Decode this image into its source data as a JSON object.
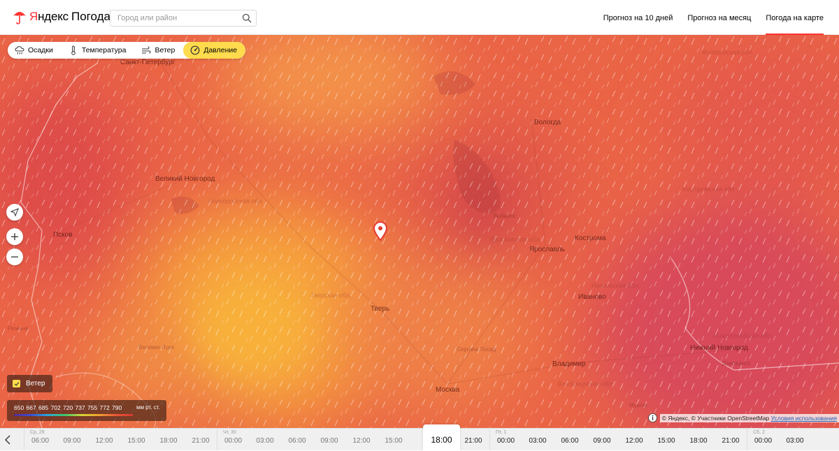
{
  "header": {
    "logo_brand_ya": "Я",
    "logo_brand_rest": "ндекс",
    "logo_product": "Погода",
    "search_placeholder": "Город или район",
    "nav": [
      {
        "label": "Прогноз на 10 дней",
        "active": false
      },
      {
        "label": "Прогноз на месяц",
        "active": false
      },
      {
        "label": "Погода на карте",
        "active": true
      }
    ]
  },
  "layers": [
    {
      "label": "Осадки",
      "icon": "cloud-rain-icon",
      "active": false
    },
    {
      "label": "Температура",
      "icon": "thermometer-icon",
      "active": false
    },
    {
      "label": "Ветер",
      "icon": "wind-icon",
      "active": false
    },
    {
      "label": "Давление",
      "icon": "gauge-icon",
      "active": true
    }
  ],
  "map_labels": {
    "cities": [
      {
        "name": "Санкт-Петербург",
        "kind": "big"
      },
      {
        "name": "Великий Новгород",
        "kind": "big"
      },
      {
        "name": "Псков",
        "kind": "big"
      },
      {
        "name": "Тверь",
        "kind": "big"
      },
      {
        "name": "Москва",
        "kind": "big"
      },
      {
        "name": "Вологда",
        "kind": "big"
      },
      {
        "name": "Ярославль",
        "kind": "big"
      },
      {
        "name": "Кострома",
        "kind": "big"
      },
      {
        "name": "Иваново",
        "kind": "big"
      },
      {
        "name": "Владимир",
        "kind": "big"
      },
      {
        "name": "Нижний Новгород",
        "kind": "big"
      },
      {
        "name": "Резекне",
        "kind": "small"
      },
      {
        "name": "Великие Луки",
        "kind": "small"
      },
      {
        "name": "Рыбинск",
        "kind": "small"
      },
      {
        "name": "Сергиев Посад",
        "kind": "small"
      },
      {
        "name": "Дзержинск",
        "kind": "small"
      },
      {
        "name": "Муром",
        "kind": "small"
      },
      {
        "name": "Новгородская обл.",
        "kind": "region"
      },
      {
        "name": "Тверская обл.",
        "kind": "region"
      },
      {
        "name": "Ярославская обл.",
        "kind": "region"
      },
      {
        "name": "Костромская обл.",
        "kind": "region"
      },
      {
        "name": "Ивановская обл.",
        "kind": "region"
      },
      {
        "name": "Владимирская обл.",
        "kind": "region"
      },
      {
        "name": "Нижегородская обл.",
        "kind": "region"
      },
      {
        "name": "Вологодская обл.",
        "kind": "region"
      }
    ]
  },
  "legend": {
    "values": [
      "650",
      "667",
      "685",
      "702",
      "720",
      "737",
      "755",
      "772",
      "790"
    ],
    "unit": "мм рт. ст."
  },
  "wind_toggle": {
    "label": "Ветер",
    "checked": true
  },
  "attribution": {
    "text": "© Яндекс, © Участники OpenStreetMap",
    "terms": "Условия использования"
  },
  "timeline": {
    "days": [
      {
        "label": "Ср, 29"
      },
      {
        "label": "Чт, 30"
      },
      {
        "label": "Пт, 1"
      },
      {
        "label": "Сб, 2"
      }
    ],
    "slots_before": [
      "06:00",
      "09:00",
      "12:00",
      "15:00",
      "18:00",
      "21:00",
      "00:00",
      "03:00",
      "06:00",
      "09:00",
      "12:00",
      "15:00"
    ],
    "current": "18:00",
    "slots_after": [
      "21:00",
      "00:00",
      "03:00",
      "06:00",
      "09:00",
      "12:00",
      "15:00",
      "18:00",
      "21:00",
      "00:00",
      "03:00"
    ]
  },
  "colors": {
    "accent_red": "#ff3333",
    "active_pill": "#ffdb4d",
    "map_base": "#ea6446"
  }
}
